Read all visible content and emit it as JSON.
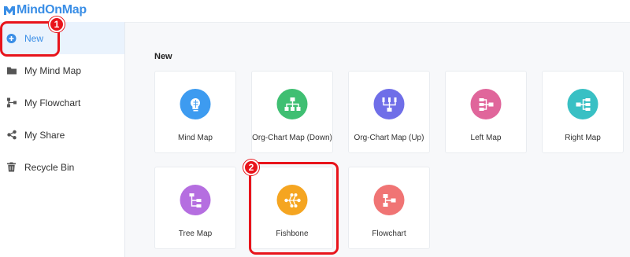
{
  "app": {
    "logo_text": "MindOnMap"
  },
  "sidebar": {
    "items": [
      {
        "label": "New",
        "icon": "plus-circle-icon",
        "active": true
      },
      {
        "label": "My Mind Map",
        "icon": "folder-icon"
      },
      {
        "label": "My Flowchart",
        "icon": "flowchart-icon"
      },
      {
        "label": "My Share",
        "icon": "share-icon"
      },
      {
        "label": "Recycle Bin",
        "icon": "trash-icon"
      }
    ]
  },
  "main": {
    "section_title": "New",
    "templates": [
      {
        "label": "Mind Map",
        "icon": "brain-icon",
        "color": "#3d9bf0"
      },
      {
        "label": "Org-Chart Map (Down)",
        "icon": "org-chart-down-icon",
        "color": "#3fbf72"
      },
      {
        "label": "Org-Chart Map (Up)",
        "icon": "org-chart-up-icon",
        "color": "#6f6ee8"
      },
      {
        "label": "Left Map",
        "icon": "left-map-icon",
        "color": "#e0669b"
      },
      {
        "label": "Right Map",
        "icon": "right-map-icon",
        "color": "#39c0c4"
      },
      {
        "label": "Tree Map",
        "icon": "tree-map-icon",
        "color": "#b56ee0"
      },
      {
        "label": "Fishbone",
        "icon": "fishbone-icon",
        "color": "#f5a521"
      },
      {
        "label": "Flowchart",
        "icon": "flowchart-template-icon",
        "color": "#f07474"
      }
    ]
  },
  "annotations": [
    {
      "number": "1",
      "target": "New"
    },
    {
      "number": "2",
      "target": "Fishbone"
    }
  ],
  "colors": {
    "accent": "#3a8ee6",
    "annotation": "#e8141b",
    "active_bg": "#eaf3fd"
  }
}
